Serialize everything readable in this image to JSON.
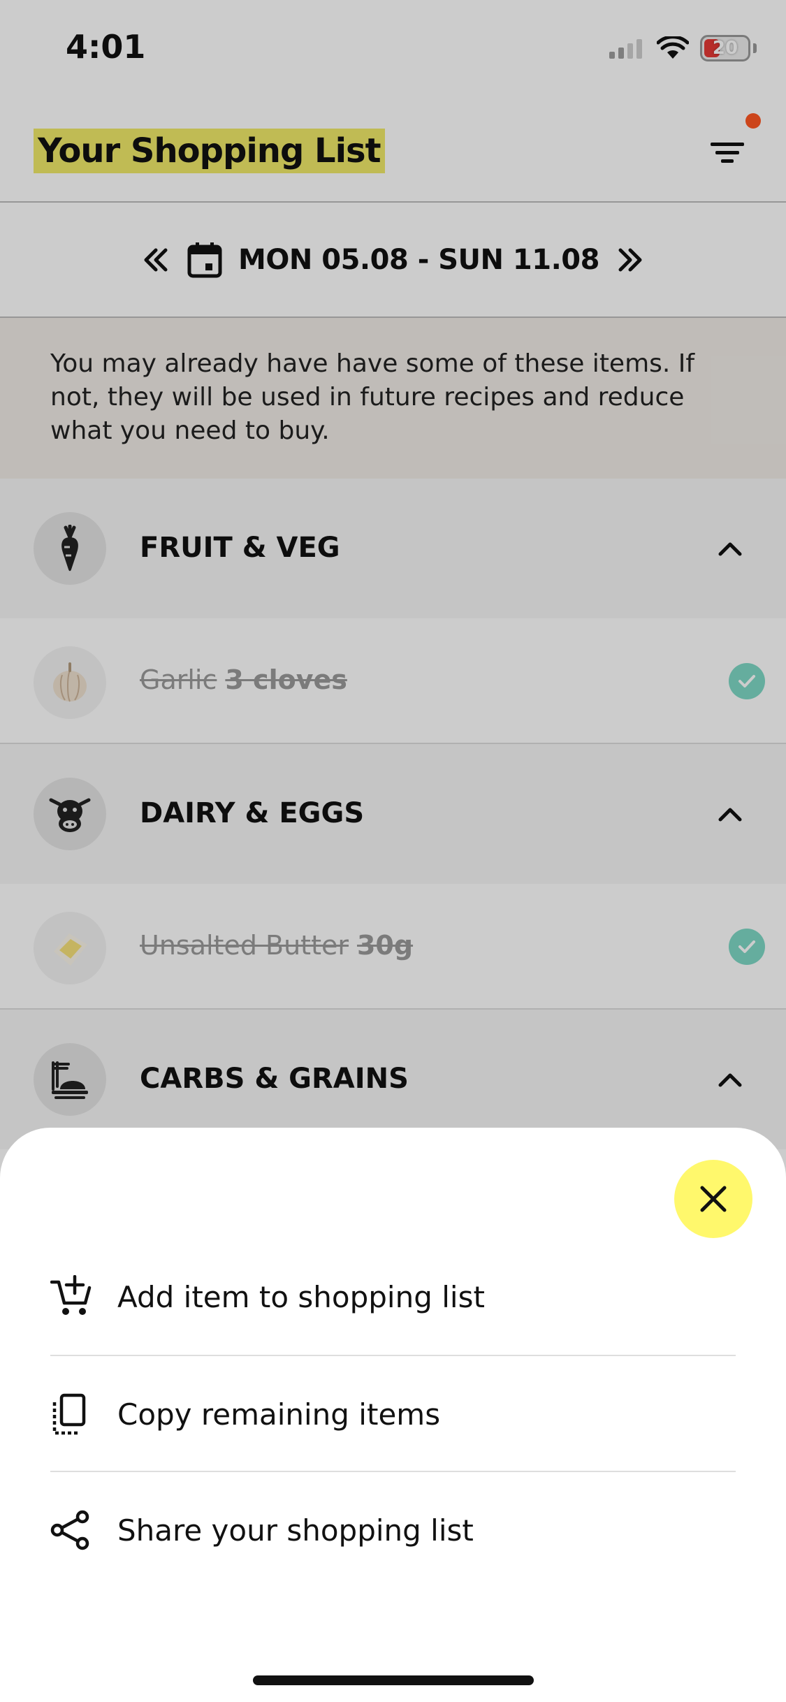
{
  "status_bar": {
    "time": "4:01",
    "battery": "20"
  },
  "header": {
    "title": "Your Shopping List",
    "filter_icon": "filter-icon",
    "has_notification": true
  },
  "week_nav": {
    "label": "MON 05.08 - SUN 11.08",
    "prev_icon": "double-chevron-left-icon",
    "next_icon": "double-chevron-right-icon",
    "calendar_icon": "calendar-icon"
  },
  "info_banner": {
    "text": "You may already have have some of these items. If not, they will be used in future recipes and reduce what you need to buy."
  },
  "categories": [
    {
      "label": "FRUIT & VEG",
      "icon": "carrot-icon",
      "expanded": true,
      "items": [
        {
          "name": "Garlic",
          "qty": "3 cloves",
          "checked": true
        }
      ]
    },
    {
      "label": "DAIRY & EGGS",
      "icon": "cow-icon",
      "expanded": true,
      "items": [
        {
          "name": "Unsalted Butter",
          "qty": "30g",
          "checked": true
        }
      ]
    },
    {
      "label": "CARBS & GRAINS",
      "icon": "pasta-icon",
      "expanded": true,
      "items": []
    }
  ],
  "sheet": {
    "close_icon": "close-icon",
    "actions": [
      {
        "label": "Add item to shopping list",
        "icon": "add-to-cart-icon"
      },
      {
        "label": "Copy remaining items",
        "icon": "copy-icon"
      },
      {
        "label": "Share your shopping list",
        "icon": "share-icon"
      }
    ]
  },
  "colors": {
    "title_highlight": "#f1ea6a",
    "close_button": "#fff86c",
    "check": "#7fd9c6",
    "notification": "#ff5722",
    "banner": "#f0ece7"
  }
}
